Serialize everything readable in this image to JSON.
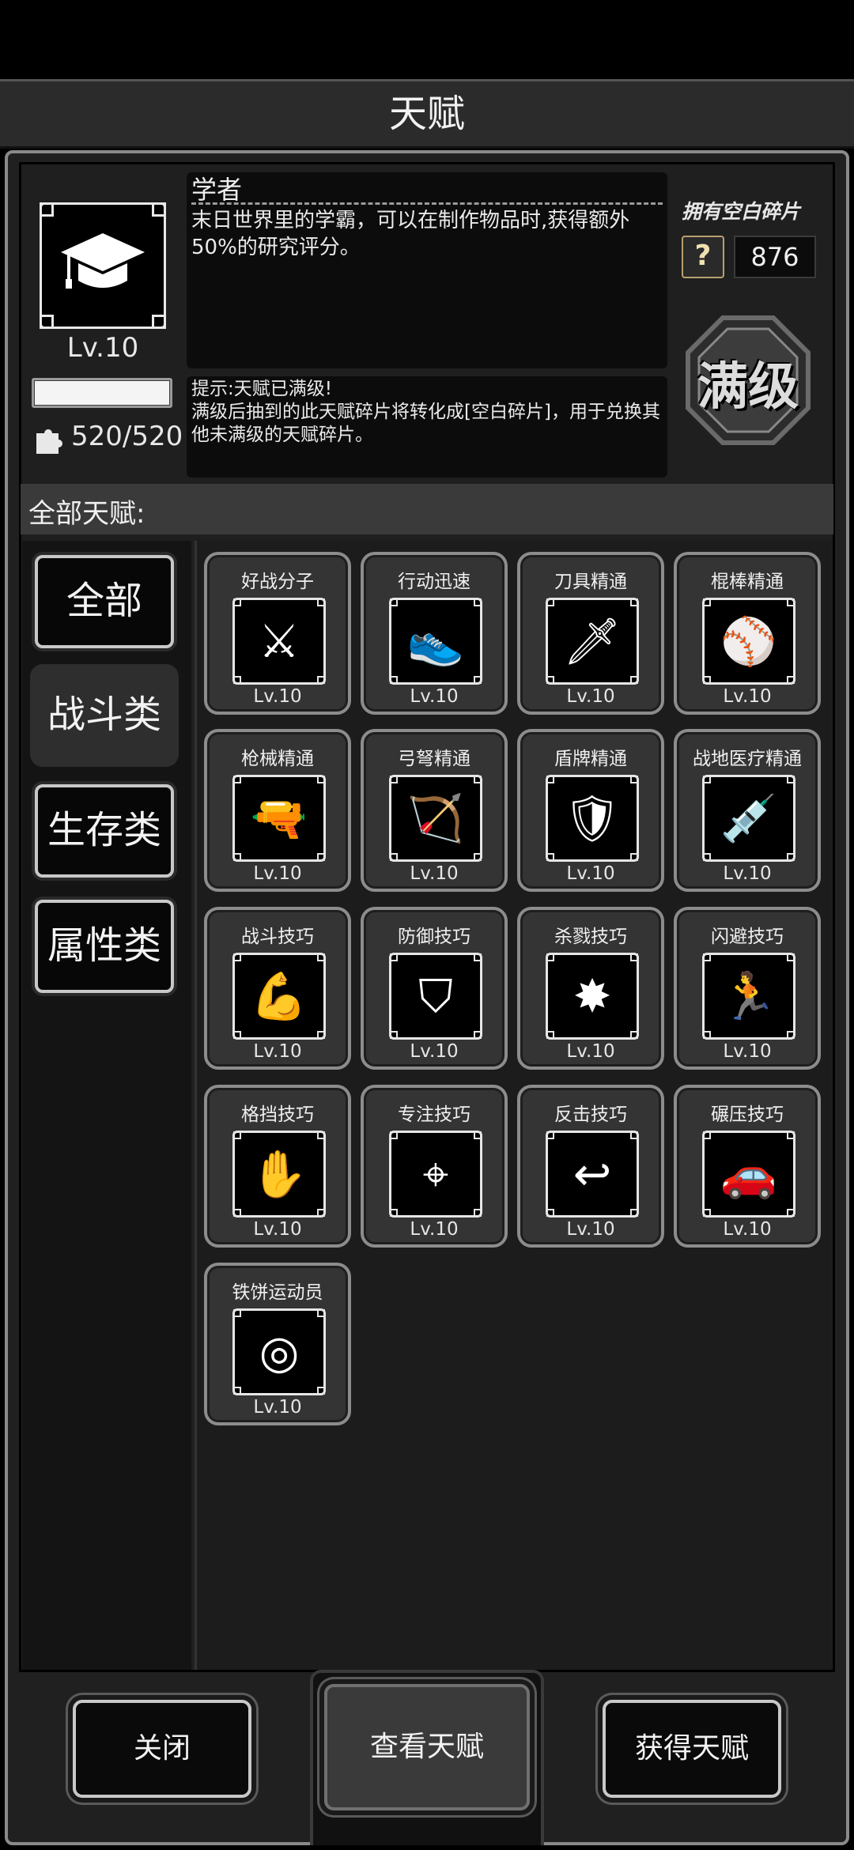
{
  "window": {
    "title": "天赋"
  },
  "talent": {
    "name": "学者",
    "description": "末日世界里的学霸，可以在制作物品时,获得额外50%的研究评分。",
    "level": "Lv.10",
    "progress": 1.0,
    "shards": "520/520",
    "hint": "提示:天赋已满级!\n满级后抽到的此天赋碎片将转化成[空白碎片]，用于兑换其他未满级的天赋碎片。",
    "icon": "graduation-cap-icon"
  },
  "blank_shards": {
    "label": "拥有空白碎片",
    "count": "876",
    "icon": "question-shard-icon"
  },
  "max_badge": {
    "text": "满级"
  },
  "section_header": "全部天赋:",
  "categories": [
    {
      "label": "全部",
      "active": false
    },
    {
      "label": "战斗类",
      "active": true
    },
    {
      "label": "生存类",
      "active": false
    },
    {
      "label": "属性类",
      "active": false
    }
  ],
  "talents": [
    {
      "name": "好战分子",
      "level": "Lv.10",
      "icon": "crossed-axes-icon",
      "glyph": "⚔"
    },
    {
      "name": "行动迅速",
      "level": "Lv.10",
      "icon": "fast-foot-icon",
      "glyph": "👟"
    },
    {
      "name": "刀具精通",
      "level": "Lv.10",
      "icon": "machete-icon",
      "glyph": "🗡"
    },
    {
      "name": "棍棒精通",
      "level": "Lv.10",
      "icon": "bat-icon",
      "glyph": "⚾"
    },
    {
      "name": "枪械精通",
      "level": "Lv.10",
      "icon": "pistol-icon",
      "glyph": "🔫"
    },
    {
      "name": "弓弩精通",
      "level": "Lv.10",
      "icon": "crossbow-icon",
      "glyph": "🏹"
    },
    {
      "name": "盾牌精通",
      "level": "Lv.10",
      "icon": "shield-icon",
      "glyph": "🛡"
    },
    {
      "name": "战地医疗精通",
      "level": "Lv.10",
      "icon": "syringe-icon",
      "glyph": "💉"
    },
    {
      "name": "战斗技巧",
      "level": "Lv.10",
      "icon": "flexed-arm-icon",
      "glyph": "💪"
    },
    {
      "name": "防御技巧",
      "level": "Lv.10",
      "icon": "defense-shield-icon",
      "glyph": "⛉"
    },
    {
      "name": "杀戮技巧",
      "level": "Lv.10",
      "icon": "crossed-blades-icon",
      "glyph": "✸"
    },
    {
      "name": "闪避技巧",
      "level": "Lv.10",
      "icon": "dodge-runner-icon",
      "glyph": "🏃"
    },
    {
      "name": "格挡技巧",
      "level": "Lv.10",
      "icon": "block-arm-icon",
      "glyph": "✋"
    },
    {
      "name": "专注技巧",
      "level": "Lv.10",
      "icon": "crosshair-icon",
      "glyph": "⌖"
    },
    {
      "name": "反击技巧",
      "level": "Lv.10",
      "icon": "counter-arm-icon",
      "glyph": "↩"
    },
    {
      "name": "碾压技巧",
      "level": "Lv.10",
      "icon": "car-crush-icon",
      "glyph": "🚗"
    },
    {
      "name": "铁饼运动员",
      "level": "Lv.10",
      "icon": "discus-icon",
      "glyph": "◎"
    }
  ],
  "buttons": {
    "close": "关闭",
    "view": "查看天赋",
    "obtain": "获得天赋"
  }
}
